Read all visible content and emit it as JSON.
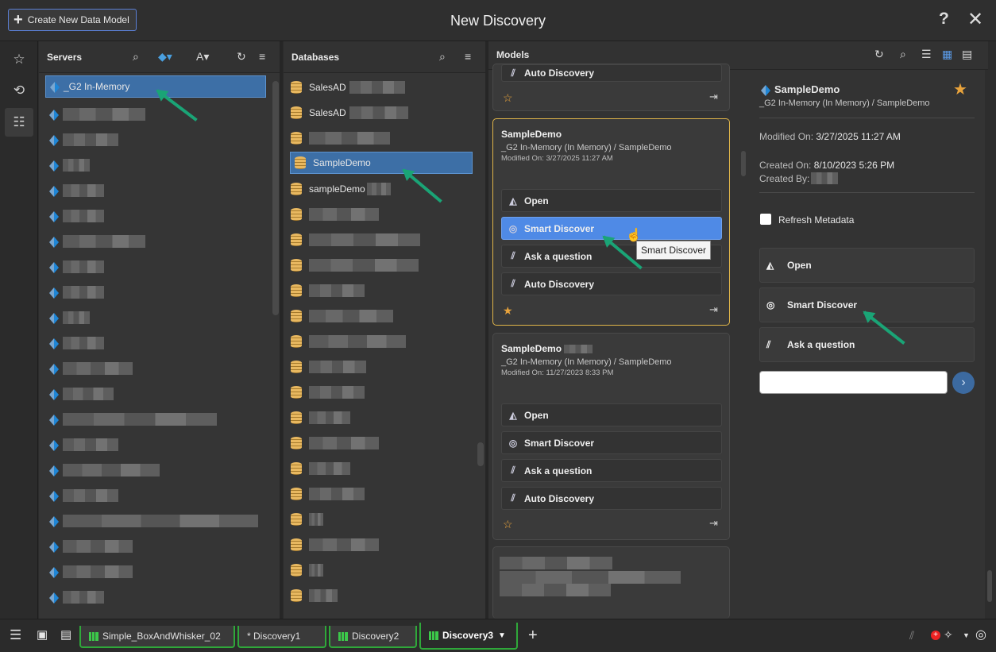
{
  "header": {
    "title": "New Discovery",
    "create_label": "Create New Data Model",
    "help": "?",
    "close": "✕"
  },
  "nav": {
    "icons": [
      "star-icon",
      "history-icon",
      "tree-icon"
    ]
  },
  "servers": {
    "header": "Servers",
    "selected": "_G2 In-Memory",
    "items_count_visible": 22
  },
  "databases": {
    "header": "Databases",
    "items": [
      "SalesAD",
      "SalesAD",
      "",
      "SampleDemo",
      "sampleDemo"
    ],
    "selected": "SampleDemo"
  },
  "models": {
    "header": "Models",
    "top_partial_action": "Auto Discovery",
    "cards": [
      {
        "name": "SampleDemo",
        "path": "_G2 In-Memory (In Memory) / SampleDemo",
        "modified": "Modified On: 3/27/2025 11:27 AM",
        "actions": [
          "Open",
          "Smart Discover",
          "Ask a question",
          "Auto Discovery"
        ],
        "starred": true
      },
      {
        "name": "SampleDemo",
        "path": "_G2 In-Memory (In Memory) / SampleDemo",
        "modified": "Modified On: 11/27/2023 8:33 PM",
        "actions": [
          "Open",
          "Smart Discover",
          "Ask a question",
          "Auto Discovery"
        ],
        "starred": false
      }
    ],
    "tooltip": "Smart Discover"
  },
  "detail": {
    "name": "SampleDemo",
    "path": "_G2 In-Memory (In Memory) / SampleDemo",
    "modified_label": "Modified On:",
    "modified_value": "3/27/2025 11:27 AM",
    "created_label": "Created On:",
    "created_value": "8/10/2023 5:26 PM",
    "created_by_label": "Created By:",
    "refresh_label": "Refresh Metadata",
    "actions": [
      "Open",
      "Smart Discover",
      "Ask a question"
    ],
    "question_value": ""
  },
  "taskbar": {
    "tabs": [
      "Simple_BoxAndWhisker_02",
      "* Discovery1",
      "Discovery2",
      "Discovery3"
    ],
    "add": "+"
  }
}
